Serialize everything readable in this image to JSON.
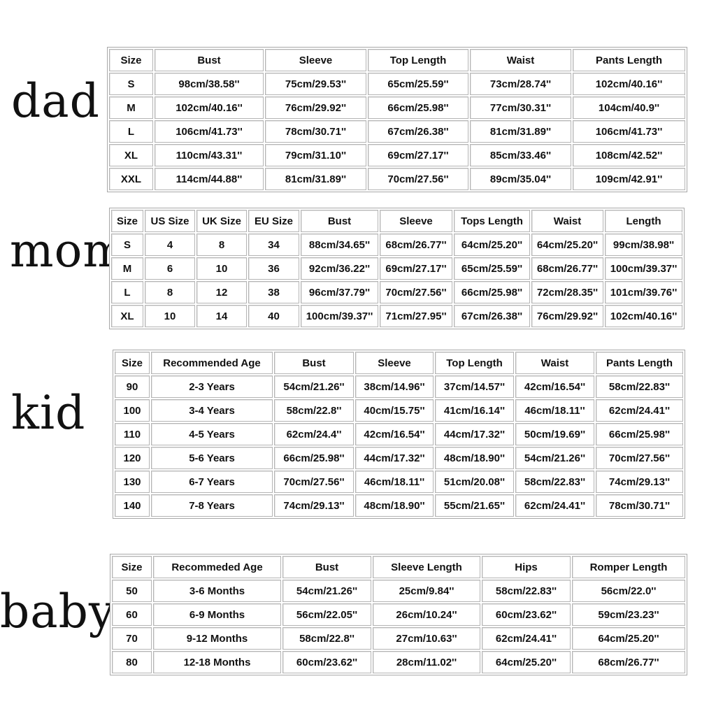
{
  "sections": [
    {
      "label": "dad",
      "headers": [
        "Size",
        "Bust",
        "Sleeve",
        "Top Length",
        "Waist",
        "Pants Length"
      ],
      "rows": [
        [
          "S",
          "98cm/38.58''",
          "75cm/29.53''",
          "65cm/25.59''",
          "73cm/28.74''",
          "102cm/40.16''"
        ],
        [
          "M",
          "102cm/40.16''",
          "76cm/29.92''",
          "66cm/25.98''",
          "77cm/30.31''",
          "104cm/40.9''"
        ],
        [
          "L",
          "106cm/41.73''",
          "78cm/30.71''",
          "67cm/26.38''",
          "81cm/31.89''",
          "106cm/41.73''"
        ],
        [
          "XL",
          "110cm/43.31''",
          "79cm/31.10''",
          "69cm/27.17''",
          "85cm/33.46''",
          "108cm/42.52''"
        ],
        [
          "XXL",
          "114cm/44.88''",
          "81cm/31.89''",
          "70cm/27.56''",
          "89cm/35.04''",
          "109cm/42.91''"
        ]
      ]
    },
    {
      "label": "mom",
      "headers": [
        "Size",
        "US Size",
        "UK Size",
        "EU Size",
        "Bust",
        "Sleeve",
        "Tops Length",
        "Waist",
        "Length"
      ],
      "rows": [
        [
          "S",
          "4",
          "8",
          "34",
          "88cm/34.65''",
          "68cm/26.77''",
          "64cm/25.20''",
          "64cm/25.20''",
          "99cm/38.98''"
        ],
        [
          "M",
          "6",
          "10",
          "36",
          "92cm/36.22''",
          "69cm/27.17''",
          "65cm/25.59''",
          "68cm/26.77''",
          "100cm/39.37''"
        ],
        [
          "L",
          "8",
          "12",
          "38",
          "96cm/37.79''",
          "70cm/27.56''",
          "66cm/25.98''",
          "72cm/28.35''",
          "101cm/39.76''"
        ],
        [
          "XL",
          "10",
          "14",
          "40",
          "100cm/39.37''",
          "71cm/27.95''",
          "67cm/26.38''",
          "76cm/29.92''",
          "102cm/40.16''"
        ]
      ]
    },
    {
      "label": "kid",
      "headers": [
        "Size",
        "Recommended Age",
        "Bust",
        "Sleeve",
        "Top Length",
        "Waist",
        "Pants Length"
      ],
      "rows": [
        [
          "90",
          "2-3 Years",
          "54cm/21.26''",
          "38cm/14.96''",
          "37cm/14.57''",
          "42cm/16.54''",
          "58cm/22.83''"
        ],
        [
          "100",
          "3-4 Years",
          "58cm/22.8''",
          "40cm/15.75''",
          "41cm/16.14''",
          "46cm/18.11''",
          "62cm/24.41''"
        ],
        [
          "110",
          "4-5 Years",
          "62cm/24.4''",
          "42cm/16.54''",
          "44cm/17.32''",
          "50cm/19.69''",
          "66cm/25.98''"
        ],
        [
          "120",
          "5-6 Years",
          "66cm/25.98''",
          "44cm/17.32''",
          "48cm/18.90''",
          "54cm/21.26''",
          "70cm/27.56''"
        ],
        [
          "130",
          "6-7 Years",
          "70cm/27.56''",
          "46cm/18.11''",
          "51cm/20.08''",
          "58cm/22.83''",
          "74cm/29.13''"
        ],
        [
          "140",
          "7-8 Years",
          "74cm/29.13''",
          "48cm/18.90''",
          "55cm/21.65''",
          "62cm/24.41''",
          "78cm/30.71''"
        ]
      ]
    },
    {
      "label": "baby",
      "headers": [
        "Size",
        "Recommeded Age",
        "Bust",
        "Sleeve Length",
        "Hips",
        "Romper Length"
      ],
      "rows": [
        [
          "50",
          "3-6 Months",
          "54cm/21.26''",
          "25cm/9.84''",
          "58cm/22.83''",
          "56cm/22.0''"
        ],
        [
          "60",
          "6-9 Months",
          "56cm/22.05''",
          "26cm/10.24''",
          "60cm/23.62''",
          "59cm/23.23''"
        ],
        [
          "70",
          "9-12 Months",
          "58cm/22.8''",
          "27cm/10.63''",
          "62cm/24.41''",
          "64cm/25.20''"
        ],
        [
          "80",
          "12-18 Months",
          "60cm/23.62''",
          "28cm/11.02''",
          "64cm/25.20''",
          "68cm/26.77''"
        ]
      ]
    }
  ]
}
